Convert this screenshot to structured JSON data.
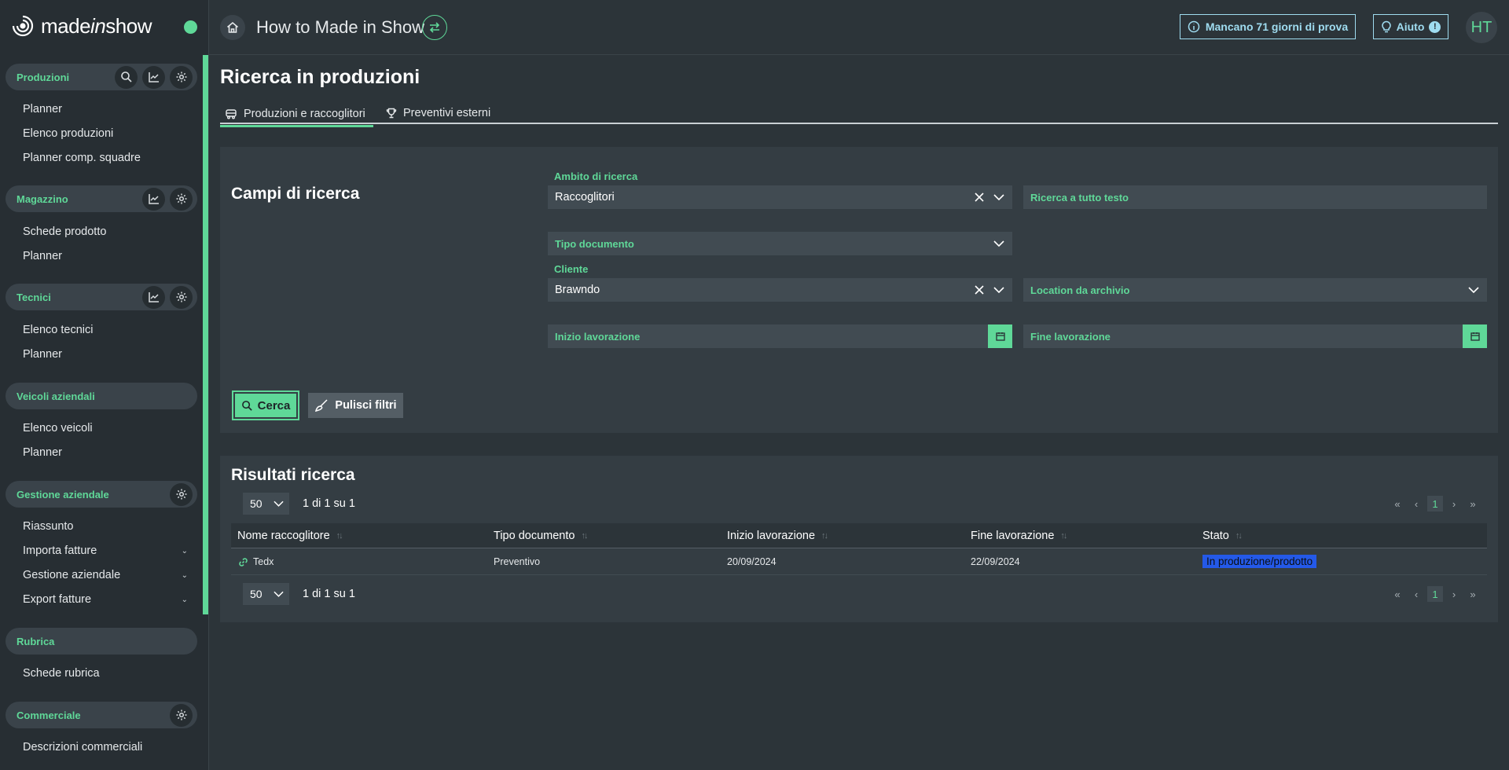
{
  "brand": {
    "pre": "made",
    "italic": "in",
    "post": "show"
  },
  "app_title": "How to Made in Show",
  "trial_label": "Mancano 71 giorni di prova",
  "help_label": "Aiuto",
  "help_badge": "!",
  "avatar_initials": "HT",
  "colors": {
    "accent": "#5fd898",
    "info": "#9fdcf0",
    "status_badge": "#2459e8"
  },
  "sidebar": {
    "sections": [
      {
        "title": "Produzioni",
        "items": [
          "Planner",
          "Elenco produzioni",
          "Planner comp. squadre"
        ]
      },
      {
        "title": "Magazzino",
        "items": [
          "Schede prodotto",
          "Planner"
        ]
      },
      {
        "title": "Tecnici",
        "items": [
          "Elenco tecnici",
          "Planner"
        ]
      },
      {
        "title": "Veicoli aziendali",
        "items": [
          "Elenco veicoli",
          "Planner"
        ]
      },
      {
        "title": "Gestione aziendale",
        "items": [
          "Riassunto",
          "Importa fatture",
          "Gestione aziendale",
          "Export fatture"
        ]
      },
      {
        "title": "Rubrica",
        "items": [
          "Schede rubrica"
        ]
      },
      {
        "title": "Commerciale",
        "items": [
          "Descrizioni commerciali"
        ]
      }
    ]
  },
  "page_title": "Ricerca in produzioni",
  "tabs": [
    "Produzioni e raccoglitori",
    "Preventivi esterni"
  ],
  "search": {
    "title": "Campi di ricerca",
    "ambito_label": "Ambito di ricerca",
    "ambito_value": "Raccoglitori",
    "fulltext_placeholder": "Ricerca a tutto testo",
    "tipo_documento_placeholder": "Tipo documento",
    "cliente_label": "Cliente",
    "cliente_value": "Brawndo",
    "location_placeholder": "Location da archivio",
    "inizio_placeholder": "Inizio lavorazione",
    "fine_placeholder": "Fine lavorazione",
    "cerca_label": "Cerca",
    "pulisci_label": "Pulisci filtri"
  },
  "results": {
    "title": "Risultati ricerca",
    "per_page": "50",
    "page_info": "1 di 1 su 1",
    "current_page": "1",
    "columns": [
      "Nome raccoglitore",
      "Tipo documento",
      "Inizio lavorazione",
      "Fine lavorazione",
      "Stato"
    ],
    "rows": [
      {
        "nome": "Tedx",
        "tipo": "Preventivo",
        "inizio": "20/09/2024",
        "fine": "22/09/2024",
        "stato": "In produzione/prodotto"
      }
    ]
  }
}
